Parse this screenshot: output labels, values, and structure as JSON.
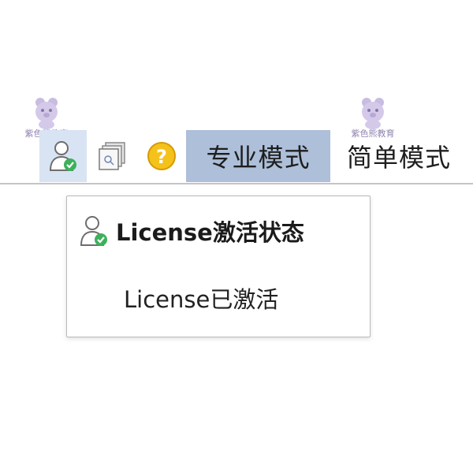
{
  "watermark": {
    "text": "紫色熊教育",
    "color": "#7d6aa6"
  },
  "toolbar": {
    "license_icon": "user-check-icon",
    "window_icon": "window-stack-icon",
    "help_icon": "question-circle-icon",
    "pro_mode_label": "专业模式",
    "simple_mode_label": "简单模式",
    "active_bg": "#adbfd9",
    "hover_bg": "#d8e3f3"
  },
  "popup": {
    "title": "License激活状态",
    "status": "License已激活"
  }
}
